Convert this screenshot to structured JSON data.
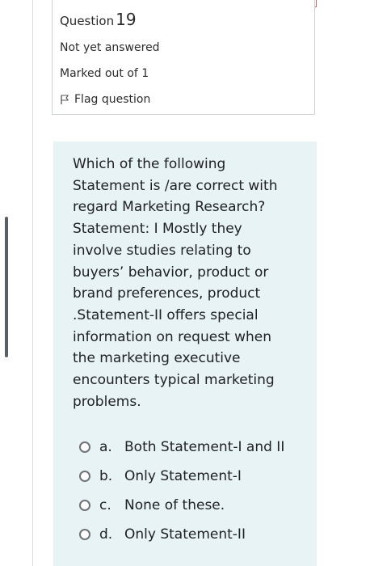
{
  "question_info": {
    "title_prefix": "Question",
    "number": "19",
    "status": "Not yet answered",
    "marks": "Marked out of 1",
    "flag_label": "Flag question"
  },
  "question": {
    "text": "Which of the following\nStatement is /are correct with\nregard Marketing Research?\nStatement: I Mostly they\ninvolve studies relating to\nbuyers’ behavior, product or\nbrand preferences, product\n.Statement-II offers special\ninformation on request when\nthe marketing executive\nencounters typical marketing\nproblems."
  },
  "answers": [
    {
      "letter": "a.",
      "text": "Both Statement-I and II"
    },
    {
      "letter": "b.",
      "text": "Only Statement-I"
    },
    {
      "letter": "c.",
      "text": "None of these."
    },
    {
      "letter": "d.",
      "text": "Only Statement-II"
    }
  ],
  "colors": {
    "question_background": "#e7f3f5",
    "border": "#cfd3d6",
    "text": "#202124"
  },
  "icons": {
    "flag": "flag-outline-icon",
    "answer_option": "radio-unchecked-icon"
  }
}
